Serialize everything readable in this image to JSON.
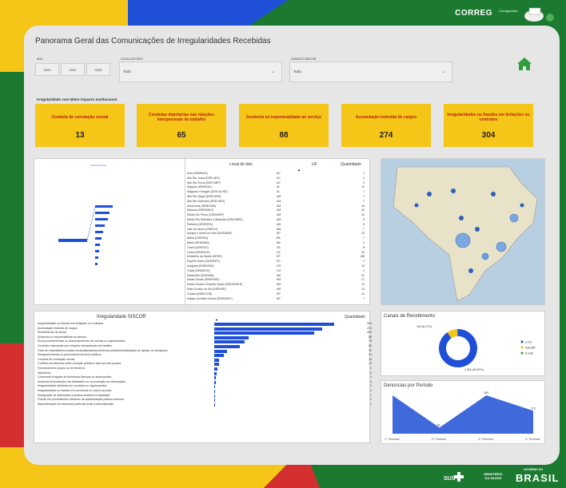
{
  "header": {
    "brand": "CORREG",
    "brand_sub": "Corregedoria"
  },
  "dashboard": {
    "title": "Panorama Geral das Comunicações de Irregularidades Recebidas"
  },
  "filters": {
    "year_label": "ANO",
    "years": [
      "2023",
      "2024",
      "2025"
    ],
    "local_label": "LOCAL DO FATO",
    "local_value": "Todo",
    "subject_label": "ASSUNTO SISCOR",
    "subject_value": "Todo"
  },
  "impact": {
    "label": "Irregularidade com Maior Impacto Institucional",
    "cards": [
      {
        "label": "Conduta de conotação sexual",
        "value": "13"
      },
      {
        "label": "Condutas impróprias nas relações interpessoais de trabalho",
        "value": "65"
      },
      {
        "label": "Ausência ou impontualidade ao serviço",
        "value": "88"
      },
      {
        "label": "Acumulação indevida de cargos",
        "value": "274"
      },
      {
        "label": "Irregularidades ou fraudes em licitações ou contratos",
        "value": "304"
      }
    ]
  },
  "local_table": {
    "headers": [
      "Local do fato",
      "UF",
      "Quantidade"
    ],
    "rows": [
      [
        "Acre (SEMS/AC)",
        "AC",
        "1"
      ],
      [
        "Alto Rio Juruá (DSEI ARJ)",
        "AC",
        "2"
      ],
      [
        "Alto Rio Purus (DSEI ARP)",
        "AC",
        "4"
      ],
      [
        "Alagoas (SEMS/AL)",
        "AL",
        "12"
      ],
      [
        "Alagoas e Sergipe (DSEI AL/SE)",
        "AL",
        "7"
      ],
      [
        "Alto Rio Negro (DSEI ARN)",
        "AM",
        "7"
      ],
      [
        "Alto Rio Solimões (DSEI ARS)",
        "AM",
        "7"
      ],
      [
        "Amazonas (SEMS/AM)",
        "AM",
        "10"
      ],
      [
        "Manaus (DSEI/MAO)",
        "AM",
        "10"
      ],
      [
        "Médio Rio Purus (DSEI/MRP)",
        "AM",
        "10"
      ],
      [
        "Médio Rio Solimões e Afluentes (DSEI/MRS)",
        "AM",
        "5"
      ],
      [
        "Parintins (DSEI/PIN)",
        "AM",
        "5"
      ],
      [
        "Vale do Javari (DSEI/VJ)",
        "AM",
        "7"
      ],
      [
        "Amapá e Norte do Pará (DSEI/ANP)",
        "AP",
        "10"
      ],
      [
        "Bahia (DSEI/BA)",
        "BA",
        "7"
      ],
      [
        "Bahia (SEMS/BA)",
        "BA",
        "4"
      ],
      [
        "Ceará (DSEI/CE)",
        "CE",
        "8"
      ],
      [
        "Ceará (SEMS/CE)",
        "CE",
        "34"
      ],
      [
        "Ministério da Saúde (SEDE)",
        "DF",
        "138"
      ],
      [
        "Espírito Santo (SEMS/ES)",
        "ES",
        "4"
      ],
      [
        "Araguaia (DSEI/ARA)",
        "GO",
        "10"
      ],
      [
        "Goiás (SEMS/GO)",
        "GO",
        "2"
      ],
      [
        "Maranhão (DSEI/MA)",
        "MA",
        "31"
      ],
      [
        "Minas Gerais (SEMS/MG)",
        "MG",
        "27"
      ],
      [
        "Minas Gerais e Espírito Santo (DSEI/MGES)",
        "MG",
        "13"
      ],
      [
        "Mato Grosso do Sul (DSEI/MS)",
        "MS",
        "13"
      ],
      [
        "Cuiabá (DSEI/CGB)",
        "MT",
        "11"
      ],
      [
        "Kaiapó do Mato Grosso (DSEI/KMT)",
        "MT",
        "7"
      ]
    ]
  },
  "siscor_table": {
    "headers": [
      "Irregularidade SISCOR",
      "Quantidade"
    ],
    "rows": [
      {
        "label": "Irregularidades ou fraudes em licitações ou contratos",
        "value": 304,
        "text": "304"
      },
      {
        "label": "Acumulação indevida de cargos",
        "value": 274,
        "text": "274"
      },
      {
        "label": "Recebimento de dívida",
        "value": 254,
        "text": "254"
      },
      {
        "label": "Ausência ou impontualidade ao serviço",
        "value": 88,
        "text": "88"
      },
      {
        "label": "Erros procedimentais ou descumprimento de normas ou regulamentos",
        "value": 78,
        "text": "78"
      },
      {
        "label": "Condutas impróprias nas relações interpessoais de trabalho",
        "value": 65,
        "text": "65"
      },
      {
        "label": "Falta de urbanidade/condutas escandalosas/incontinência pública/manifestação de apreço ou desapreço",
        "value": 32,
        "text": "32"
      },
      {
        "label": "Desaparecimento ou perecimento de bens públicos",
        "value": 24,
        "text": "24"
      },
      {
        "label": "Conduta de conotação sexual",
        "value": 13,
        "text": "13"
      },
      {
        "label": "Conflitos de interesse entre a função pública e atos da vida privada",
        "value": 12,
        "text": "12"
      },
      {
        "label": "Favorecimento próprio ou de terceiros",
        "value": 9,
        "text": "9"
      },
      {
        "label": "Nepotismo",
        "value": 6,
        "text": "6"
      },
      {
        "label": "Concessão irregular de benefícios licenças ou autorizações",
        "value": 4,
        "text": "4"
      },
      {
        "label": "Ausência de prestação nas atividades ou na promoção da informações",
        "value": 4,
        "text": "4"
      },
      {
        "label": "Irregularidades definidas em sumários ou regulamentos",
        "value": 3,
        "text": "3"
      },
      {
        "label": "Irregularidades ou fraudes em convênios ou outros acordos",
        "value": 2,
        "text": "2"
      },
      {
        "label": "Designação de atribuições à pessoa estranha à repartição",
        "value": 1,
        "text": "1"
      },
      {
        "label": "Fraude em procedimento licitatório da administração pública nacional",
        "value": 1,
        "text": "1"
      },
      {
        "label": "Representação de interesses particular junto à administração",
        "value": 1,
        "text": "1"
      }
    ],
    "max": 304
  },
  "channels": {
    "title": "Canais de Recebimento",
    "slices": [
      {
        "name": "e-OU",
        "value": 1316,
        "label": "1.316 (90,57%)",
        "color": "#1e4fd6"
      },
      {
        "name": "Fala.BR",
        "value": 125,
        "label": "100 (6,17%)",
        "color": "#f5c518"
      },
      {
        "name": "E-mail",
        "value": 12,
        "label": "",
        "color": "#2e9e3a"
      }
    ]
  },
  "period": {
    "title": "Denúncias por Período",
    "categories": [
      "1º Trimestre",
      "2º Trimestre",
      "3º Trimestre",
      "4º Trimestre"
    ],
    "values": [
      289,
      46,
      289,
      173
    ],
    "labels": [
      "",
      "46",
      "289",
      "173"
    ],
    "color": "#1e4fd6"
  },
  "footer": {
    "sus": "SUS",
    "ministry": "MINISTÉRIO DA SAÚDE",
    "gov": "GOVERNO DO",
    "country": "BRASIL"
  }
}
